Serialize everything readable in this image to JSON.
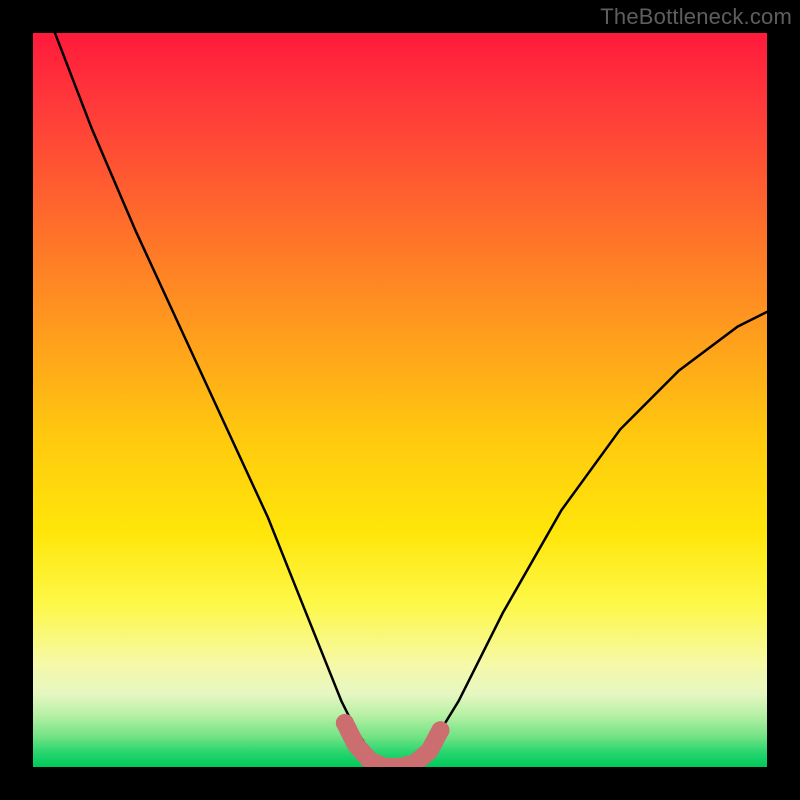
{
  "watermark": "TheBottleneck.com",
  "chart_data": {
    "type": "line",
    "title": "",
    "xlabel": "",
    "ylabel": "",
    "xlim": [
      0,
      100
    ],
    "ylim": [
      0,
      100
    ],
    "series": [
      {
        "name": "curve",
        "x": [
          3,
          8,
          14,
          20,
          26,
          32,
          36,
          40,
          42,
          44,
          46,
          48,
          50,
          52,
          54,
          58,
          64,
          72,
          80,
          88,
          96,
          100
        ],
        "y": [
          100,
          87,
          73,
          60,
          47,
          34,
          24,
          14,
          9,
          5,
          2,
          0.5,
          0,
          0.5,
          2.5,
          9,
          21,
          35,
          46,
          54,
          60,
          62
        ]
      }
    ],
    "highlight": {
      "name": "trough-highlight",
      "x": [
        42.5,
        44,
        46,
        48,
        50,
        52,
        54,
        55.5
      ],
      "y": [
        6,
        3,
        0.8,
        0,
        0,
        0.5,
        2.2,
        5
      ]
    },
    "colors": {
      "curve": "#000000",
      "highlight": "#cc6d70"
    }
  }
}
